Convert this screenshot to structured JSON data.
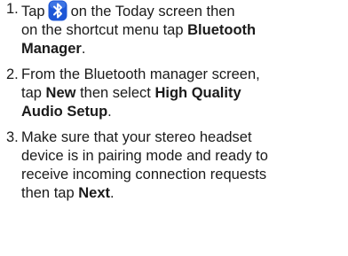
{
  "steps": [
    {
      "number": "1.",
      "line1_pre": "Tap",
      "icon": "bluetooth-icon",
      "line1_post": "on the Today screen then",
      "line2_pre": "on the shortcut menu tap",
      "line2_bold": "Bluetooth",
      "line3_bold": "Manager",
      "line3_post": "."
    },
    {
      "number": "2.",
      "line1": "From the Bluetooth manager screen,",
      "line2_pre": "tap",
      "line2_bold1": "New",
      "line2_mid": "then select",
      "line2_bold2": "High Quality",
      "line3_bold": "Audio Setup",
      "line3_post": "."
    },
    {
      "number": "3.",
      "line1": "Make sure that your stereo headset",
      "line2": "device is in pairing mode and ready to",
      "line3": "receive incoming connection requests",
      "line4_pre": "then tap",
      "line4_bold": "Next",
      "line4_post": "."
    }
  ],
  "colors": {
    "text": "#1a1a1a",
    "icon_bg": "#1e57d6",
    "icon_symbol": "#ffffff"
  }
}
